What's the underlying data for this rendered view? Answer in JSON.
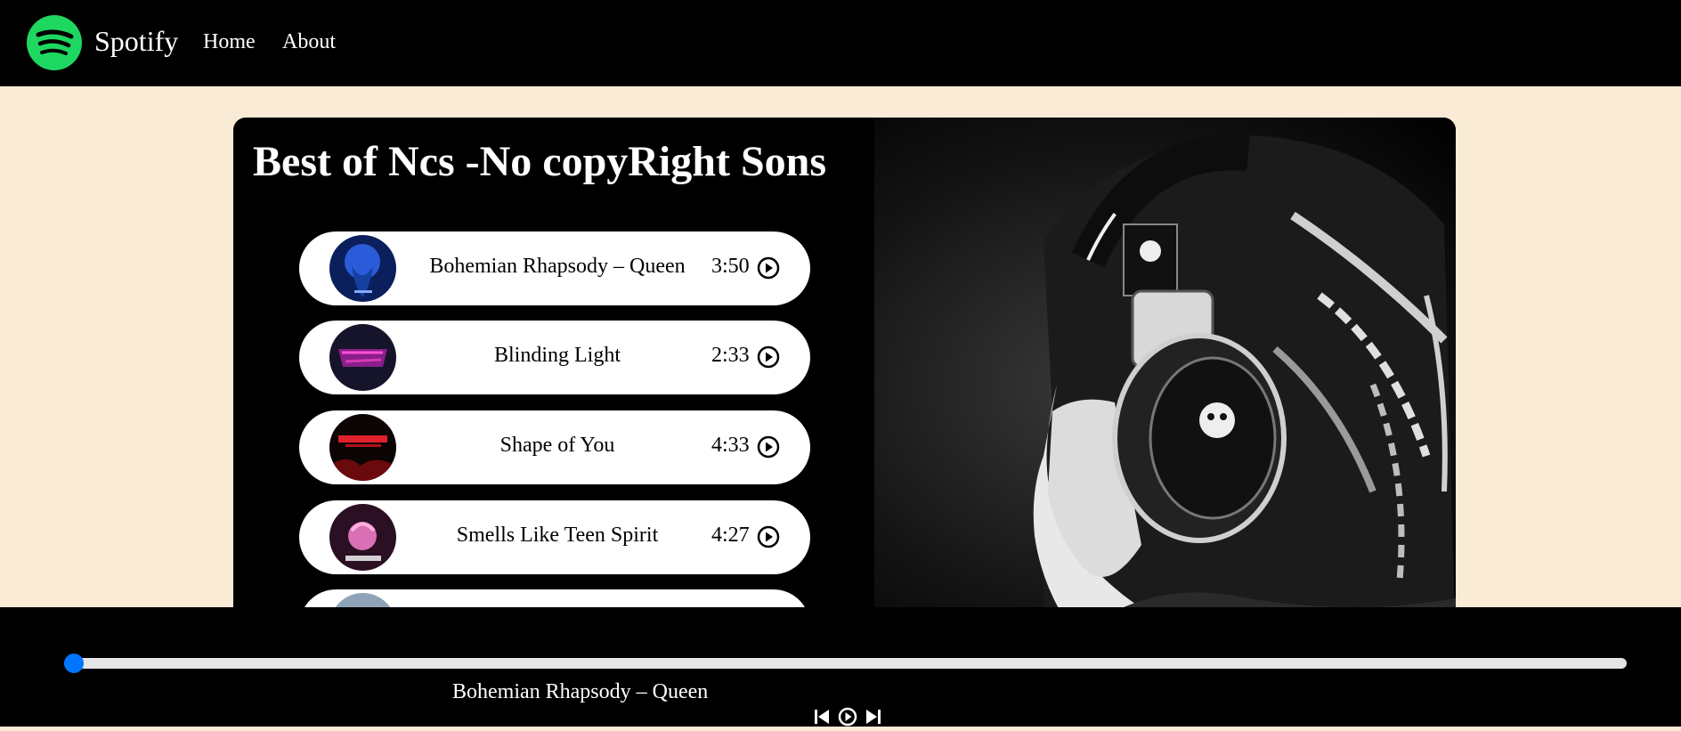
{
  "nav": {
    "brand": "Spotify",
    "links": [
      "Home",
      "About"
    ],
    "brand_color": "#1ed760"
  },
  "playlist": {
    "title": "Best of Ncs -No copyRight Sons",
    "songs": [
      {
        "name": "Bohemian Rhapsody – Queen",
        "duration": "3:50",
        "cover_color": "#1a3a8a"
      },
      {
        "name": "Blinding Light",
        "duration": "2:33",
        "cover_color": "#2a1a3a"
      },
      {
        "name": "Shape of You",
        "duration": "4:33",
        "cover_color": "#3a0808"
      },
      {
        "name": "Smells Like Teen Spirit",
        "duration": "4:27",
        "cover_color": "#4a1a3a"
      }
    ]
  },
  "player": {
    "current_song": "Bohemian Rhapsody – Queen",
    "progress": 0,
    "accent_color": "#0075ff",
    "icons": [
      "previous-icon",
      "play-circle-icon",
      "next-icon"
    ]
  }
}
